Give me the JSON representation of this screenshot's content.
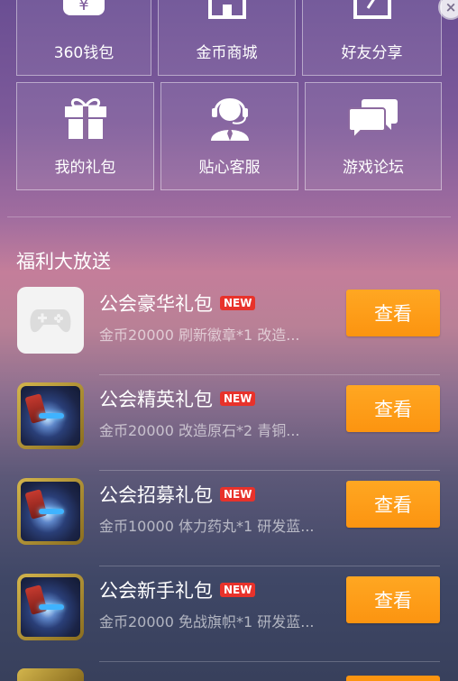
{
  "menu": {
    "tiles_top": [
      {
        "label": "360钱包",
        "icon": "wallet-icon"
      },
      {
        "label": "金币商城",
        "icon": "shop-icon"
      },
      {
        "label": "好友分享",
        "icon": "share-icon"
      }
    ],
    "tiles_bottom": [
      {
        "label": "我的礼包",
        "icon": "gift-icon"
      },
      {
        "label": "贴心客服",
        "icon": "customer-service-icon"
      },
      {
        "label": "游戏论坛",
        "icon": "forum-icon"
      }
    ]
  },
  "section": {
    "title": "福利大放送"
  },
  "gifts": [
    {
      "name": "公会豪华礼包",
      "badge": "NEW",
      "desc": "金币20000 刷新徽章*1 改造...",
      "button": "查看",
      "icon": "gamepad-icon"
    },
    {
      "name": "公会精英礼包",
      "badge": "NEW",
      "desc": "金币20000 改造原石*2 青铜...",
      "button": "查看",
      "icon": "game-icon"
    },
    {
      "name": "公会招募礼包",
      "badge": "NEW",
      "desc": "金币10000 体力药丸*1 研发蓝...",
      "button": "查看",
      "icon": "game-icon"
    },
    {
      "name": "公会新手礼包",
      "badge": "NEW",
      "desc": "金币20000 免战旗帜*1 研发蓝...",
      "button": "查看",
      "icon": "game-icon"
    }
  ],
  "colors": {
    "accent": "#fc9410",
    "badge": "#e8322b"
  }
}
